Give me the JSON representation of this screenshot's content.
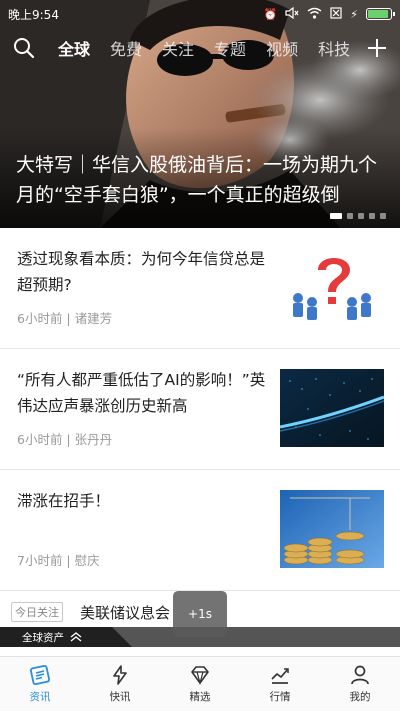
{
  "status_bar": {
    "time": "晚上9:54",
    "battery_level": 0.9
  },
  "nav": {
    "tabs": [
      {
        "label": "全球",
        "active": true
      },
      {
        "label": "免费"
      },
      {
        "label": "关注"
      },
      {
        "label": "专题"
      },
      {
        "label": "视频"
      },
      {
        "label": "科技"
      }
    ]
  },
  "hero": {
    "title": "大特写｜华信入股俄油背后：一场为期九个月的“空手套白狼”，一个真正的超级倒",
    "slides_total": 5,
    "slide_active": 1
  },
  "news": [
    {
      "title": "透过现象看本质：为何今年信贷总是超预期?",
      "time": "6小时前",
      "author": "诸建芳"
    },
    {
      "title": "“所有人都严重低估了AI的影响！”英伟达应声暴涨创历史新高",
      "time": "6小时前",
      "author": "张丹丹"
    },
    {
      "title": "滞涨在招手！",
      "time": "7小时前",
      "author": "慰庆"
    }
  ],
  "partial": {
    "tag": "今日关注",
    "title": "美联储议息会"
  },
  "global_assets": {
    "label": "全球资产"
  },
  "toast": {
    "text": "+1s"
  },
  "tabbar": [
    {
      "label": "资讯",
      "icon": "news-icon",
      "active": true
    },
    {
      "label": "快讯",
      "icon": "flash-icon"
    },
    {
      "label": "精选",
      "icon": "diamond-icon"
    },
    {
      "label": "行情",
      "icon": "chart-icon"
    },
    {
      "label": "我的",
      "icon": "user-icon"
    }
  ],
  "colors": {
    "accent": "#2a8de0",
    "meta": "#9a9a9a"
  }
}
